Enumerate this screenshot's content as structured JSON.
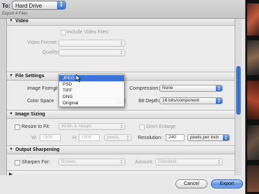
{
  "header": {
    "to_label": "To:",
    "destination": "Hard Drive",
    "export_count": "Export 4 Files"
  },
  "video": {
    "title": "Video",
    "include_label": "Include Video Files:",
    "format_label": "Video Format:",
    "quality_label": "Quality:"
  },
  "file_settings": {
    "title": "File Settings",
    "image_format_label": "Image Format",
    "color_space_label": "Color Space",
    "compression_label": "Compression:",
    "compression_value": "None",
    "bit_depth_label": "Bit Depth:",
    "bit_depth_value": "16 bits/component",
    "menu": {
      "checkmark": "✓",
      "items": [
        "JPEG",
        "PSD",
        "TIFF",
        "DNG",
        "Original"
      ],
      "highlighted": "JPEG",
      "checked": "TIFF"
    }
  },
  "image_sizing": {
    "title": "Image Sizing",
    "resize_label": "Resize to Fit:",
    "resize_mode": "Width & Height",
    "dont_enlarge_label": "Don't Enlarge",
    "w_label": "W:",
    "w_value": "1000",
    "h_label": "H:",
    "h_value": "1000",
    "unit": "pixels",
    "resolution_label": "Resolution:",
    "resolution_value": "240",
    "resolution_unit": "pixels per inch"
  },
  "output_sharpening": {
    "title": "Output Sharpening",
    "sharpen_label": "Sharpen For:",
    "sharpen_value": "Screen",
    "amount_label": "Amount:",
    "amount_value": "Standard"
  },
  "buttons": {
    "cancel": "Cancel",
    "export": "Export"
  },
  "colors": {
    "accent": "#3d72d8",
    "dialog_bg": "#e8e8e8"
  }
}
